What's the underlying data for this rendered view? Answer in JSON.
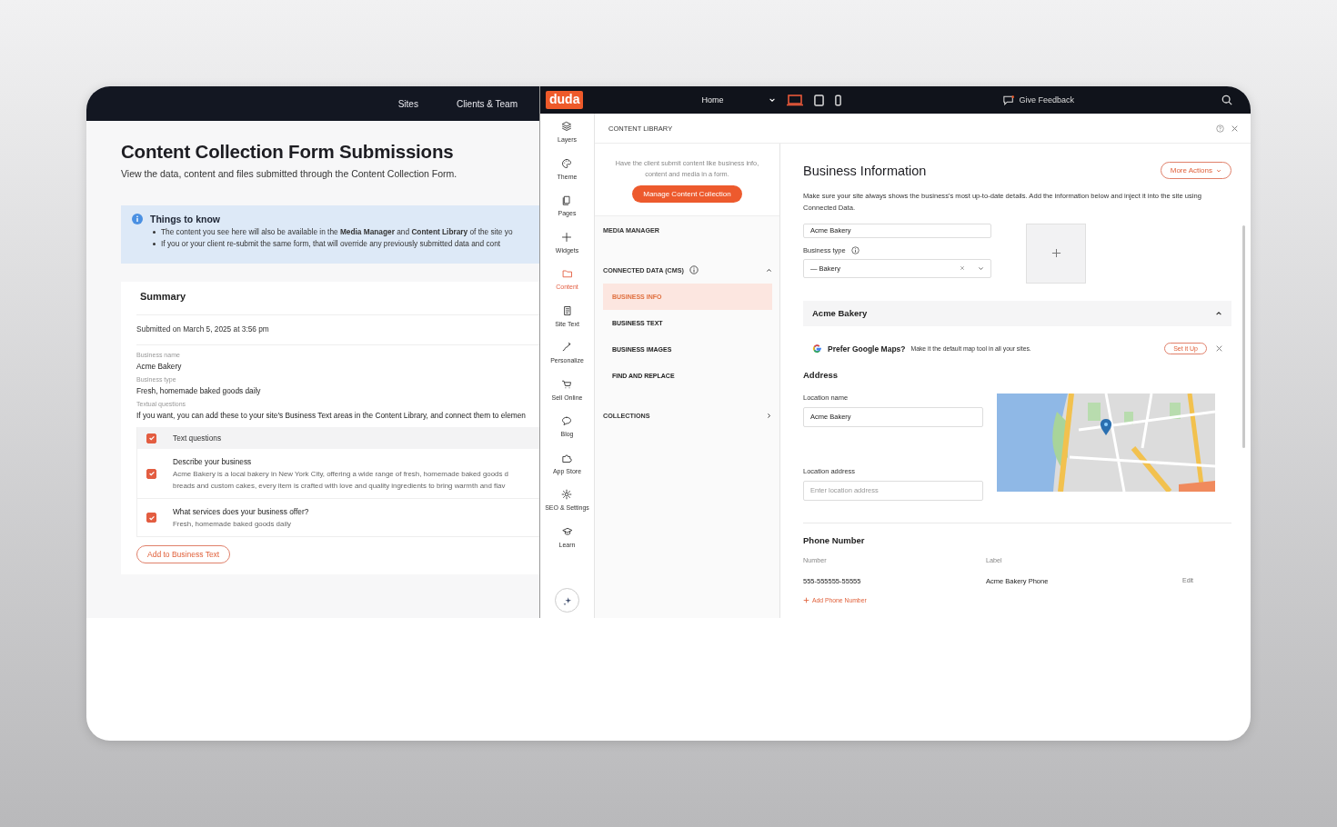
{
  "left_nav": {
    "links": [
      "Sites",
      "Clients & Team"
    ]
  },
  "submissions": {
    "title": "Content Collection Form Submissions",
    "subtitle": "View the data, content and files submitted through the Content Collection Form.",
    "notice": {
      "title": "Things to know",
      "items": [
        "The content you see here will also be available in the **Media Manager** and **Content Library** of the site yo",
        "If you or your client re-submit the same form, that will override any previously submitted data and cont"
      ]
    },
    "summary": {
      "heading": "Summary",
      "submitted": "Submitted on March 5, 2025 at 3:56 pm",
      "fields": [
        {
          "label": "Business name",
          "value": "Acme Bakery"
        },
        {
          "label": "Business type",
          "value": "Fresh, homemade baked goods daily"
        },
        {
          "label": "Textual questions",
          "value": "If you want, you can add these to your site's Business Text areas in the Content Library, and connect them to elemen"
        }
      ]
    },
    "questions": {
      "header": {
        "label": "Text questions",
        "checked": true
      },
      "items": [
        {
          "question": "Describe your business",
          "answer_lines": [
            "Acme Bakery is a local bakery in New York City, offering a wide range of fresh, homemade baked goods d",
            "breads and custom cakes, every item is crafted with love and quality ingredients to bring warmth and flav"
          ],
          "checked": true
        },
        {
          "question": "What services does your business offer?",
          "answer_lines": [
            "Fresh, homemade baked goods daily"
          ],
          "checked": true
        }
      ]
    },
    "add_button": "Add to Business Text"
  },
  "editor_bar": {
    "logo": "duda",
    "page": "Home",
    "devices": [
      {
        "kind": "desktop",
        "selected": true
      },
      {
        "kind": "tablet",
        "selected": false
      },
      {
        "kind": "mobile",
        "selected": false
      }
    ],
    "feedback": "Give Feedback"
  },
  "sidebar": {
    "items": [
      {
        "label": "Layers",
        "selected": false
      },
      {
        "label": "Theme",
        "selected": false
      },
      {
        "label": "Pages",
        "selected": false
      },
      {
        "label": "Widgets",
        "selected": false
      },
      {
        "label": "Content",
        "selected": true
      },
      {
        "label": "Site Text",
        "selected": false
      },
      {
        "label": "Personalize",
        "selected": false
      },
      {
        "label": "Sell Online",
        "selected": false
      },
      {
        "label": "Blog",
        "selected": false
      },
      {
        "label": "App Store",
        "selected": false
      },
      {
        "label": "SEO & Settings",
        "selected": false
      },
      {
        "label": "Learn",
        "selected": false
      }
    ]
  },
  "content_library": {
    "title": "CONTENT LIBRARY",
    "intro": "Have the client submit content like business info, content and media in a form.",
    "button": "Manage Content Collection",
    "sections": [
      {
        "label": "MEDIA MANAGER"
      },
      {
        "label": "CONNECTED DATA (CMS)",
        "info": true,
        "expanded": true,
        "items": [
          {
            "label": "BUSINESS INFO",
            "selected": true
          },
          {
            "label": "BUSINESS TEXT",
            "selected": false
          },
          {
            "label": "BUSINESS IMAGES",
            "selected": false
          },
          {
            "label": "FIND AND REPLACE",
            "selected": false
          }
        ]
      },
      {
        "label": "COLLECTIONS",
        "expanded": false
      }
    ]
  },
  "business_info": {
    "title": "Business Information",
    "more_actions": "More Actions",
    "description": "Make sure your site always shows the business's most up-to-date details. Add the information below and inject it into the site using Connected Data.",
    "name_value": "Acme Bakery",
    "type_label": "Business type",
    "type_value": "— Bakery",
    "location": {
      "title": "Acme Bakery",
      "expanded": true,
      "banner": {
        "title": "Prefer Google Maps?",
        "text": "Make it the default map tool in all your sites.",
        "button": "Set it Up"
      },
      "address_heading": "Address",
      "name_label": "Location name",
      "name_value": "Acme Bakery",
      "address_label": "Location address",
      "address_placeholder": "Enter location address",
      "phone": {
        "heading": "Phone Number",
        "columns": [
          "Number",
          "Label"
        ],
        "rows": [
          {
            "number": "555-555555-55555",
            "label": "Acme Bakery Phone",
            "action": "Edit"
          }
        ],
        "add": "Add Phone Number"
      }
    }
  }
}
